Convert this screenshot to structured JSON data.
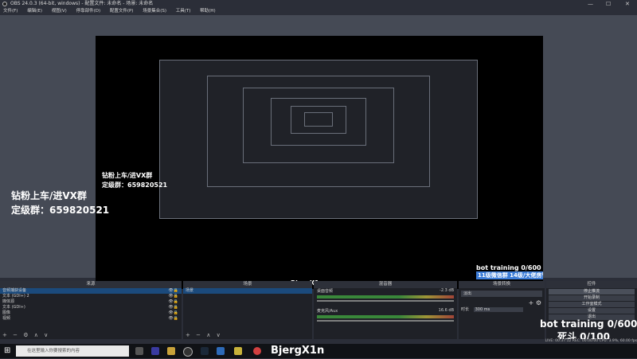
{
  "window": {
    "title": "OBS 24.0.3 (64-bit, windows) - 配置文件: 未命名 - 场景: 未命名",
    "min": "—",
    "max": "☐",
    "close": "✕"
  },
  "menu": [
    "文件(F)",
    "编辑(E)",
    "视图(V)",
    "停靠部件(D)",
    "配置文件(P)",
    "场景集合(S)",
    "工具(T)",
    "帮助(H)"
  ],
  "overlays": {
    "join_line": "钻粉上车/进VX群",
    "group_line": "定级群：659820521",
    "bot_training": "bot training 0/600",
    "death": "死斗 0/100",
    "wechat_group": "11级微信群 14级/大佬房管",
    "username": "BjergX1n"
  },
  "sources": {
    "header": "来源",
    "items": [
      {
        "label": "音频捕获设备",
        "selected": true
      },
      {
        "label": "文本 (GDI+) 2",
        "selected": false
      },
      {
        "label": "媒体源",
        "selected": false
      },
      {
        "label": "文本 (GDI+)",
        "selected": false
      },
      {
        "label": "图像",
        "selected": false
      },
      {
        "label": "视频",
        "selected": false
      }
    ],
    "toolbar": [
      "+",
      "−",
      "⚙",
      "∧",
      "∨"
    ]
  },
  "scenes": {
    "header": "场景",
    "items": [
      {
        "label": "场景",
        "selected": true
      }
    ],
    "toolbar": [
      "+",
      "−",
      "∧",
      "∨"
    ]
  },
  "mixer": {
    "header": "混音器",
    "channels": [
      {
        "name": "桌面音频",
        "db": "-2.3 dB"
      },
      {
        "name": "麦克风/Aux",
        "db": "16.6 dB"
      }
    ]
  },
  "transitions": {
    "header": "场景转换",
    "current": "淡出",
    "duration_label": "时长",
    "duration_value": "300 ms",
    "add": "+",
    "settings": "⚙"
  },
  "controls": {
    "header": "控件",
    "buttons": [
      "停止推流",
      "开始录制",
      "工作室模式",
      "设置",
      "退出"
    ]
  },
  "status": {
    "text": "LIVE: 00:37:12   REC: 00:00:00   CPU: 3.9%, 60.00 fps"
  },
  "taskbar": {
    "search_placeholder": "在这里输入你要搜索的内容",
    "tray_time": "",
    "icons": [
      "task-view-icon",
      "edge-icon",
      "file-explorer-icon",
      "obs-icon",
      "steam-icon",
      "game-icon",
      "weibo-icon"
    ]
  },
  "colors": {
    "accent_blue": "#1b4a7c",
    "overlay_box": "#3b7bd6"
  }
}
